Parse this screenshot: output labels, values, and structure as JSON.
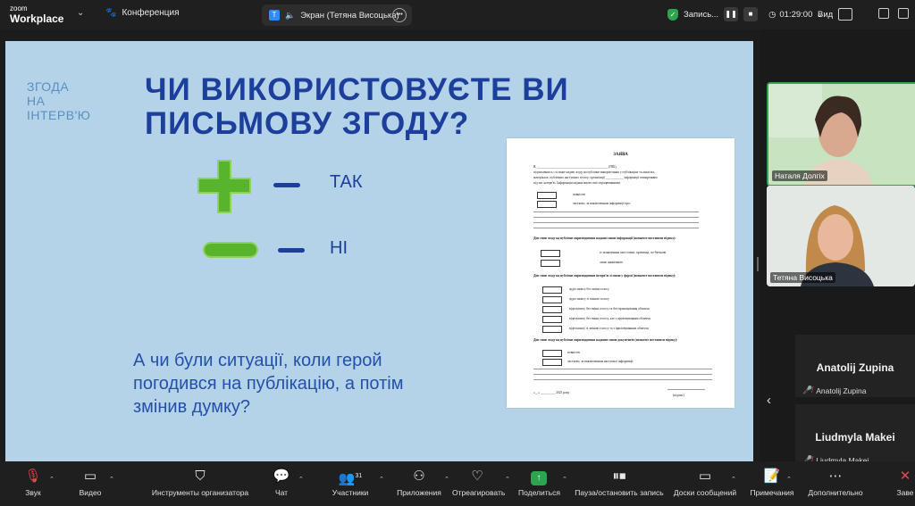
{
  "topbar": {
    "logo_line1": "zoom",
    "logo_line2": "Workplace",
    "meeting_label": "Конференция",
    "tab_title": "Экран (Тетяна Висоцька)",
    "recording_label": "Запись...",
    "timer": "01:29:00",
    "view_label": "Вид"
  },
  "slide": {
    "section": [
      "ЗГОДА",
      "НА",
      "ІНТЕРВ'Ю"
    ],
    "title_line1": "ЧИ ВИКОРИСТОВУЄТЕ ВИ",
    "title_line2": "ПИСЬМОВУ ЗГОДУ?",
    "yes_label": "ТАК",
    "no_label": "НІ",
    "question_lines": [
      "А чи були ситуації, коли герой",
      "погодився на публікацію, а потім",
      "змінив думку?"
    ],
    "document": {
      "heading": "ЗАЯВА",
      "lines": [
        "Я, ____________________________________________ (ПІБ),",
        "підписавшись слі може надаю згоду на публічне використання у публікаціях та аналізах,",
        "матеріалах, публічних наступних голосу, організації ___________ інформації поширенням",
        "під час інтерв'ю. Інформація надана мною свої опрацюваннями"
      ],
      "opt1": "повністю",
      "opt2": "частково, за виключенням інформації про:",
      "sec1": "Дію свою згоду на публічне оприлюднення наданої мною інформації (позначте поставити відмку):",
      "sec1_opt1": "із зазначенням мого імені, прізвища, по-батькові",
      "sec1_opt2": "лише анонімною",
      "sec2": "Дію свою згоду на публічне оприлюднення інтерв'ю зі мною у формі (позначте поставити відмку):",
      "sec2_opts": [
        "аудіо запису без зміни голосу",
        "аудіо запису зі зміною голосу",
        "відеозапису без зміни голосу та без приховування обличчя",
        "відеозапису без зміни голосу, але з приховуванням обличчя",
        "відеозапису зі зміною голосу та з приховуванням обличчя"
      ],
      "sec3": "Дію свою згоду на публічне оприлюднення наданих мною документів (позначте поставити відмку):",
      "sec3_opt1": "повністю",
      "sec3_opt2": "частково, за виключенням наступної інформації:",
      "date": "«__» _________ 2023 року",
      "sign": "(підпис)"
    }
  },
  "participants": {
    "video1_name": "Наталя Долгіх",
    "video2_name": "Тетяна Висоцька",
    "p3_big": "Anatolij Zupina",
    "p3_small": "Anatolij Zupina",
    "p4_big": "Liudmyla Makei",
    "p4_small": "Liudmyla Makei"
  },
  "toolbar": {
    "audio": "Звук",
    "video": "Видео",
    "host_tools": "Инструменты организатора",
    "chat": "Чат",
    "participants": "Участники",
    "participants_count": "31",
    "apps": "Приложения",
    "react": "Отреагировать",
    "share": "Поделиться",
    "pause_record": "Пауза/остановить запись",
    "whiteboards": "Доски сообщений",
    "notes": "Примечания",
    "more": "Дополнительно",
    "end_partial": "Заве"
  },
  "colors": {
    "accent_green": "#2ea44f",
    "slide_bg": "#b4d3e8",
    "title_blue": "#1d3f9c",
    "plus_green": "#58b42c"
  }
}
